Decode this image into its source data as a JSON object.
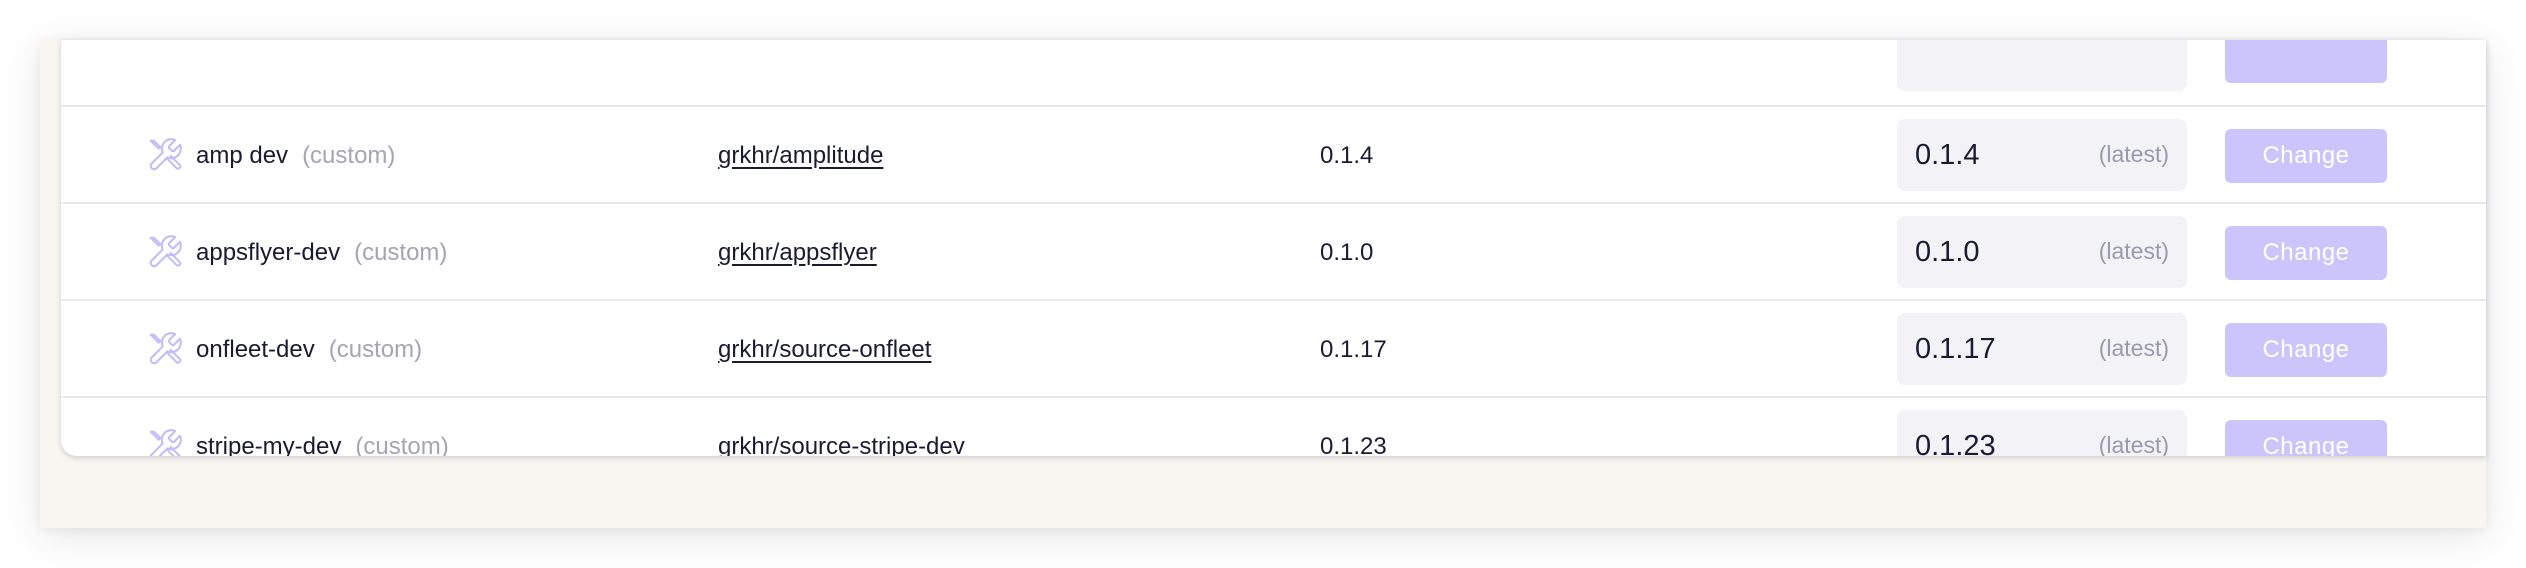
{
  "connectors": [
    {
      "name": "amp dev",
      "tag": "(custom)",
      "repo": "grkhr/amplitude",
      "current_version": "0.1.4",
      "selected_version": "0.1.4",
      "latest_label": "(latest)",
      "action_label": "Change"
    },
    {
      "name": "appsflyer-dev",
      "tag": "(custom)",
      "repo": "grkhr/appsflyer",
      "current_version": "0.1.0",
      "selected_version": "0.1.0",
      "latest_label": "(latest)",
      "action_label": "Change"
    },
    {
      "name": "onfleet-dev",
      "tag": "(custom)",
      "repo": "grkhr/source-onfleet",
      "current_version": "0.1.17",
      "selected_version": "0.1.17",
      "latest_label": "(latest)",
      "action_label": "Change"
    },
    {
      "name": "stripe-my-dev",
      "tag": "(custom)",
      "repo": "grkhr/source-stripe-dev",
      "current_version": "0.1.23",
      "selected_version": "0.1.23",
      "latest_label": "(latest)",
      "action_label": "Change"
    }
  ],
  "colors": {
    "accent_button": "#cbc5fb",
    "icon_stroke": "#c2bdf6",
    "page_background": "#f9f6f1"
  },
  "icons": {
    "connector_icon": "wrench-screwdriver-icon"
  }
}
